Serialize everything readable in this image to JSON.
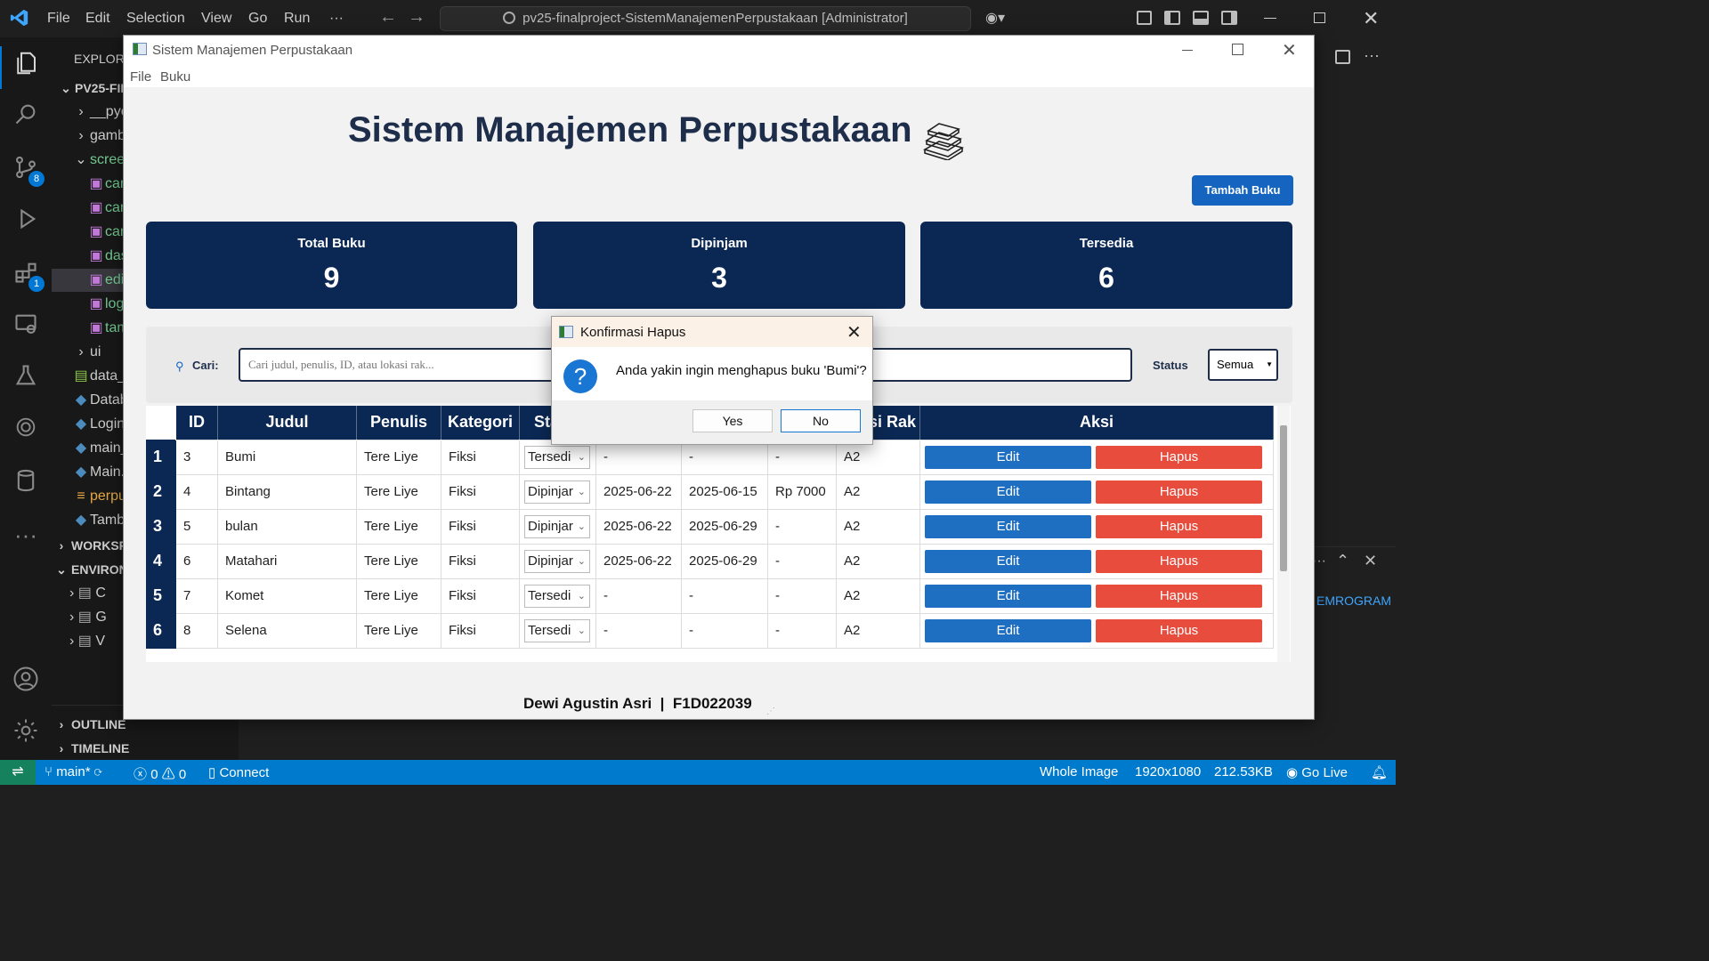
{
  "vscode": {
    "menu": [
      "File",
      "Edit",
      "Selection",
      "View",
      "Go",
      "Run",
      "···"
    ],
    "command_center": "pv25-finalproject-SistemManajemenPerpustakaan [Administrator]",
    "badges": {
      "source_control": "8",
      "extensions": "1"
    },
    "explorer_label": "EXPLORE",
    "tree": [
      {
        "label": "PV25-FIN",
        "type": "folder-open"
      },
      {
        "label": "__pyc",
        "type": "folder"
      },
      {
        "label": "gamb",
        "type": "folder"
      },
      {
        "label": "scree",
        "type": "folder-open"
      },
      {
        "label": "cari",
        "type": "image"
      },
      {
        "label": "cari",
        "type": "image"
      },
      {
        "label": "cari",
        "type": "image"
      },
      {
        "label": "dasl",
        "type": "image"
      },
      {
        "label": "edit",
        "type": "image"
      },
      {
        "label": "logi",
        "type": "image"
      },
      {
        "label": "tam",
        "type": "image"
      },
      {
        "label": "ui",
        "type": "folder"
      },
      {
        "label": "data_",
        "type": "db"
      },
      {
        "label": "Datab",
        "type": "python"
      },
      {
        "label": "Login",
        "type": "python"
      },
      {
        "label": "main_",
        "type": "python"
      },
      {
        "label": "Main.",
        "type": "python"
      },
      {
        "label": "perpu",
        "type": "file"
      },
      {
        "label": "Tamb",
        "type": "python"
      }
    ],
    "sections": [
      "WORKSP",
      "ENVIRON",
      "OUTLINE",
      "TIMELINE"
    ],
    "env_items": [
      "C",
      "G",
      "V"
    ],
    "panel_text": "EMROGRAM",
    "status": {
      "branch": "main*",
      "errors": "0",
      "warnings": "0",
      "connect": "Connect",
      "whole_image": "Whole Image",
      "dims": "1920x1080",
      "size": "212.53KB",
      "go_live": "Go Live"
    }
  },
  "app": {
    "window_title": "Sistem Manajemen Perpustakaan",
    "menu": [
      "File",
      "Buku"
    ],
    "heading": "Sistem Manajemen Perpustakaan",
    "add_button": "Tambah Buku",
    "stats": [
      {
        "label": "Total Buku",
        "value": "9"
      },
      {
        "label": "Dipinjam",
        "value": "3"
      },
      {
        "label": "Tersedia",
        "value": "6"
      }
    ],
    "search_label": "Cari:",
    "search_placeholder": "Cari judul, penulis, ID, atau lokasi rak...",
    "status_label": "Status",
    "status_value": "Semua",
    "columns": [
      "ID",
      "Judul",
      "Penulis",
      "Kategori",
      "Sta",
      "",
      "",
      "",
      "asi Rak",
      "Aksi"
    ],
    "rows": [
      {
        "n": "1",
        "id": "3",
        "judul": "Bumi",
        "penulis": "Tere Liye",
        "kategori": "Fiksi",
        "status": "Tersedi",
        "pinjam": "-",
        "kembali": "-",
        "denda": "-",
        "rak": "A2"
      },
      {
        "n": "2",
        "id": "4",
        "judul": "Bintang",
        "penulis": "Tere Liye",
        "kategori": "Fiksi",
        "status": "Dipinjar",
        "pinjam": "2025-06-22",
        "kembali": "2025-06-15",
        "denda": "Rp 7000",
        "rak": "A2"
      },
      {
        "n": "3",
        "id": "5",
        "judul": "bulan",
        "penulis": "Tere Liye",
        "kategori": "Fiksi",
        "status": "Dipinjar",
        "pinjam": "2025-06-22",
        "kembali": "2025-06-29",
        "denda": "-",
        "rak": "A2"
      },
      {
        "n": "4",
        "id": "6",
        "judul": "Matahari",
        "penulis": "Tere Liye",
        "kategori": "Fiksi",
        "status": "Dipinjar",
        "pinjam": "2025-06-22",
        "kembali": "2025-06-29",
        "denda": "-",
        "rak": "A2"
      },
      {
        "n": "5",
        "id": "7",
        "judul": "Komet",
        "penulis": "Tere Liye",
        "kategori": "Fiksi",
        "status": "Tersedi",
        "pinjam": "-",
        "kembali": "-",
        "denda": "-",
        "rak": "A2"
      },
      {
        "n": "6",
        "id": "8",
        "judul": "Selena",
        "penulis": "Tere Liye",
        "kategori": "Fiksi",
        "status": "Tersedi",
        "pinjam": "-",
        "kembali": "-",
        "denda": "-",
        "rak": "A2"
      }
    ],
    "edit_label": "Edit",
    "hapus_label": "Hapus",
    "footer": "Dewi Agustin Asri  |  F1D022039"
  },
  "dialog": {
    "title": "Konfirmasi Hapus",
    "message": "Anda yakin ingin menghapus buku 'Bumi'?",
    "yes": "Yes",
    "no": "No"
  }
}
